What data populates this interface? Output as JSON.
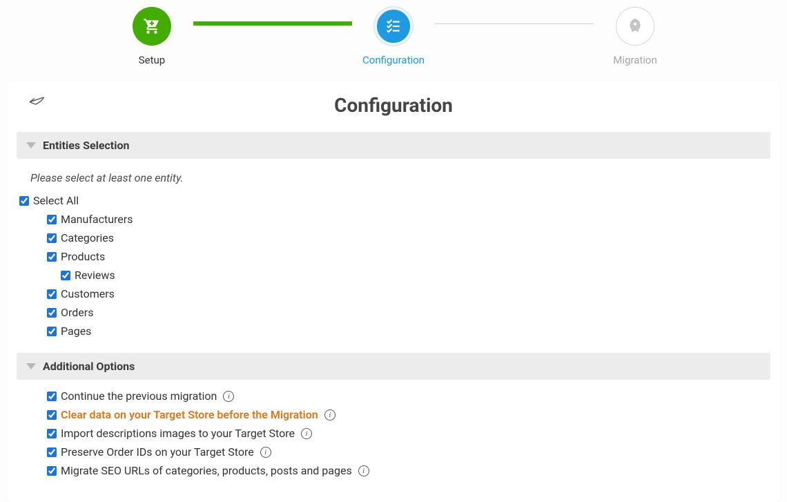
{
  "stepper": {
    "setup": {
      "label": "Setup"
    },
    "configuration": {
      "label": "Configuration"
    },
    "migration": {
      "label": "Migration"
    }
  },
  "page": {
    "title": "Configuration"
  },
  "sections": {
    "entities": {
      "title": "Entities Selection",
      "hint": "Please select at least one entity.",
      "select_all": "Select All",
      "items": {
        "manufacturers": "Manufacturers",
        "categories": "Categories",
        "products": "Products",
        "reviews": "Reviews",
        "customers": "Customers",
        "orders": "Orders",
        "pages": "Pages"
      }
    },
    "options": {
      "title": "Additional Options",
      "items": {
        "continue_previous": "Continue the previous migration",
        "clear_target": "Clear data on your Target Store before the Migration",
        "import_desc_images": "Import descriptions images to your Target Store",
        "preserve_order_ids": "Preserve Order IDs on your Target Store",
        "migrate_seo_urls": "Migrate SEO URLs of categories, products, posts and pages"
      }
    }
  }
}
